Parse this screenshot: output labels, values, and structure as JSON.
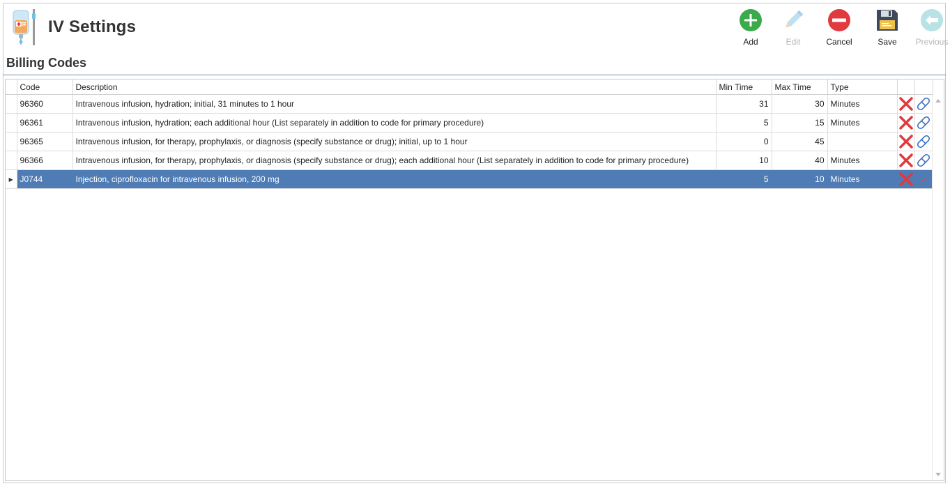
{
  "app": {
    "title": "IV Settings"
  },
  "toolbar": {
    "add": {
      "label": "Add",
      "icon": "plus-circle-icon",
      "color": "#3aaa4a"
    },
    "edit": {
      "label": "Edit",
      "icon": "pencil-icon",
      "disabled": true
    },
    "cancel": {
      "label": "Cancel",
      "icon": "no-entry-icon",
      "color": "#e0393e"
    },
    "save": {
      "label": "Save",
      "icon": "floppy-disk-icon"
    },
    "previous": {
      "label": "Previous",
      "icon": "back-arrow-icon",
      "disabled": true
    }
  },
  "section": {
    "title": "Billing Codes"
  },
  "grid": {
    "columns": {
      "code": "Code",
      "description": "Description",
      "min_time": "Min Time",
      "max_time": "Max Time",
      "type": "Type"
    },
    "rows": [
      {
        "code": "96360",
        "description": "Intravenous infusion, hydration; initial, 31 minutes to 1 hour",
        "min_time": "31",
        "max_time": "30",
        "type": "Minutes"
      },
      {
        "code": "96361",
        "description": "Intravenous infusion, hydration; each additional hour (List separately in addition to code for primary procedure)",
        "min_time": "5",
        "max_time": "15",
        "type": "Minutes"
      },
      {
        "code": "96365",
        "description": "Intravenous infusion, for therapy, prophylaxis, or diagnosis (specify substance or drug); initial, up to 1 hour",
        "min_time": "0",
        "max_time": "45",
        "type": ""
      },
      {
        "code": "96366",
        "description": "Intravenous infusion, for therapy, prophylaxis, or diagnosis (specify substance or drug); each additional hour (List separately in addition to code for primary procedure)",
        "min_time": "10",
        "max_time": "40",
        "type": "Minutes"
      },
      {
        "code": "J0744",
        "description": "Injection, ciprofloxacin for intravenous infusion, 200 mg",
        "min_time": "5",
        "max_time": "10",
        "type": "Minutes"
      }
    ],
    "selected_row_index": 4
  },
  "colors": {
    "accent": "#4f7cb4",
    "delete": "#e0393e",
    "edit_icon": "#3a6fc4"
  }
}
